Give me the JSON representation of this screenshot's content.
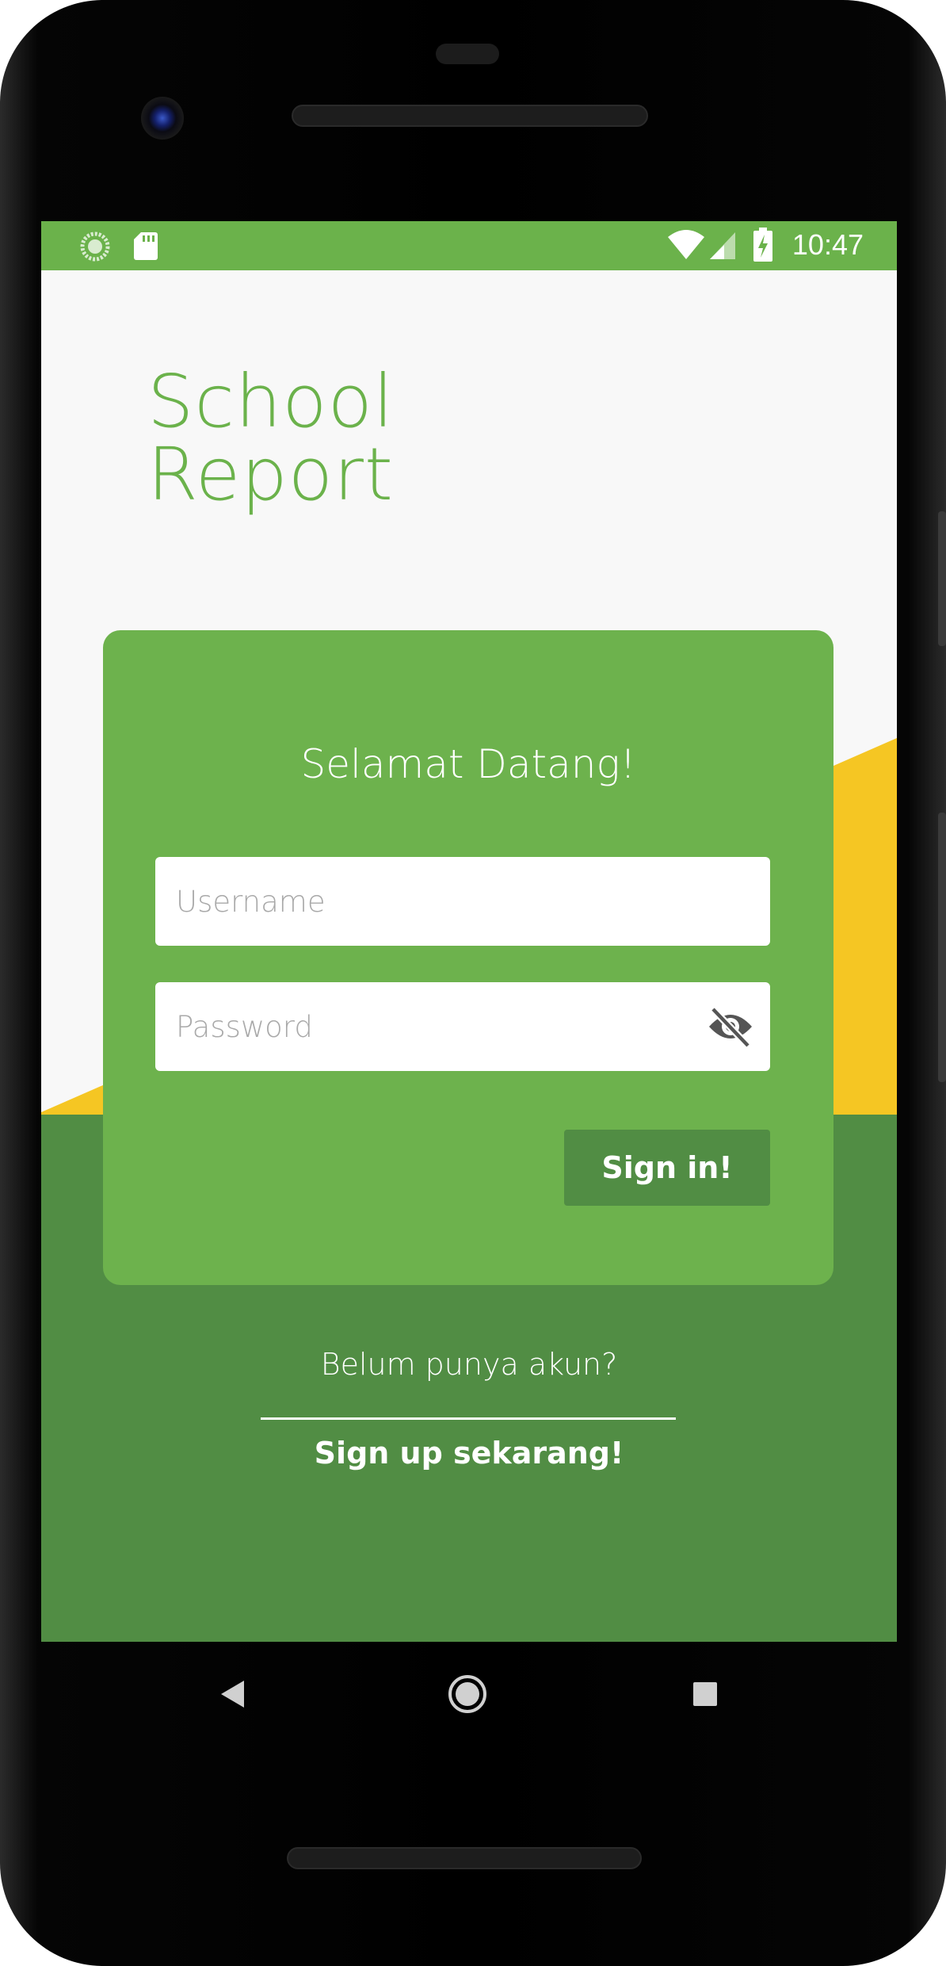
{
  "status_bar": {
    "time": "10:47",
    "icons": [
      "loading-circle-icon",
      "sd-card-icon",
      "wifi-icon",
      "cell-signal-icon",
      "battery-charging-icon"
    ]
  },
  "app": {
    "title_line1": "School",
    "title_line2": "Report"
  },
  "login_card": {
    "heading": "Selamat Datang!",
    "username_placeholder": "Username",
    "password_placeholder": "Password",
    "signin_label": "Sign in!"
  },
  "signup": {
    "prompt": "Belum punya akun?",
    "link_label": "Sign up sekarang!"
  },
  "navigation": {
    "buttons": [
      "back-icon",
      "home-icon",
      "recents-icon"
    ]
  },
  "colors": {
    "primary_green": "#6bb24b",
    "dark_green": "#518d44",
    "accent_yellow": "#f5c623",
    "background": "#f8f8f8"
  }
}
